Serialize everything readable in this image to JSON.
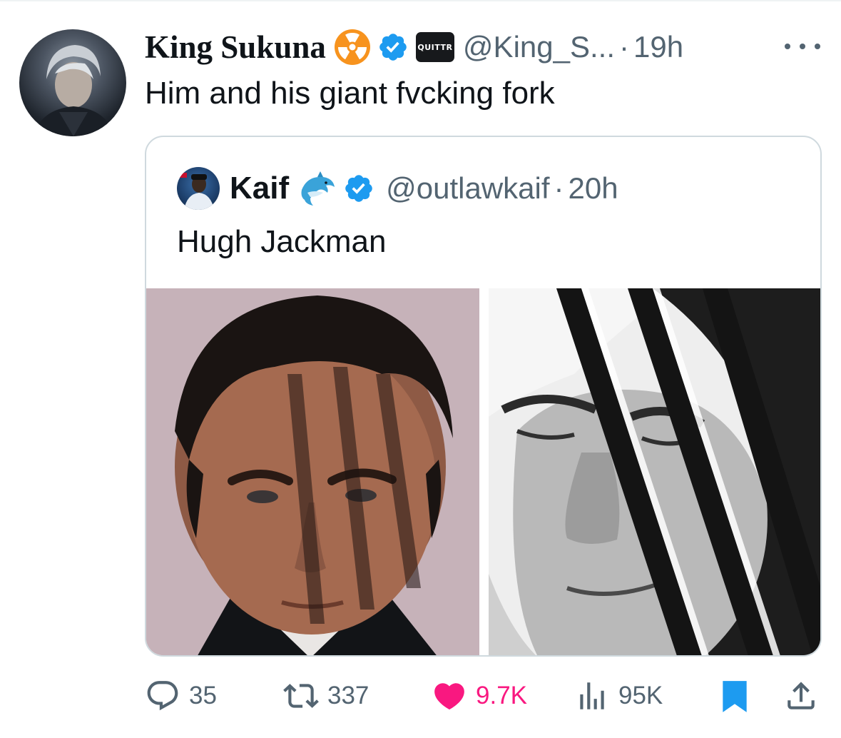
{
  "tweet": {
    "author_name": "King Sukuna",
    "author_badge_icon": "radioactive-icon",
    "affiliate_badge": "QUITTR",
    "handle": "@King_S...",
    "separator": "·",
    "time": "19h",
    "text": "Him and his giant fvcking fork"
  },
  "quoted_tweet": {
    "author_name": "Kaif",
    "author_badge_icon": "dolphin-icon",
    "handle": "@outlawkaif",
    "separator": "·",
    "time": "20h",
    "text": "Hugh Jackman"
  },
  "actions": {
    "replies": "35",
    "retweets": "337",
    "likes": "9.7K",
    "views": "95K"
  },
  "colors": {
    "verified": "#1d9bf0",
    "like": "#f91880",
    "bookmark": "#1d9bf0",
    "muted_text": "#536471",
    "border": "#cfd9de"
  }
}
